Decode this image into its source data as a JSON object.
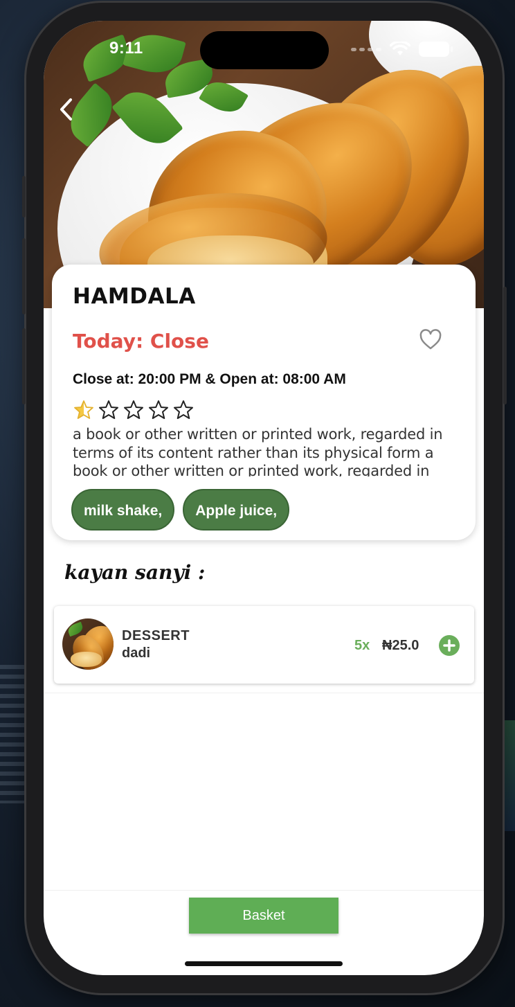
{
  "status_bar": {
    "time": "9:11"
  },
  "navigation": {
    "back_icon": "chevron-left-icon"
  },
  "shop": {
    "name": "HAMDALA",
    "today_status": "Today: Close",
    "hours": "Close at: 20:00 PM & Open at: 08:00 AM",
    "rating": 0.5,
    "rating_max": 5,
    "favorite_icon": "heart-outline-icon",
    "description": "a book or other written or printed work, regarded in terms of its content rather than its physical form a book or other written or printed work, regarded in",
    "tags": [
      "milk shake,",
      "Apple juice,"
    ]
  },
  "section": {
    "title": "kayan sanyi :"
  },
  "menu_items": [
    {
      "category": "DESSERT",
      "name": "dadi",
      "quantity": "5x",
      "price": "₦25.0",
      "add_icon": "plus-circle-icon"
    }
  ],
  "footer": {
    "basket_label": "Basket"
  },
  "colors": {
    "accent_green": "#5fae55",
    "tag_green": "#4b7c45",
    "status_red": "#e0514a",
    "star_yellow": "#f5c842"
  }
}
